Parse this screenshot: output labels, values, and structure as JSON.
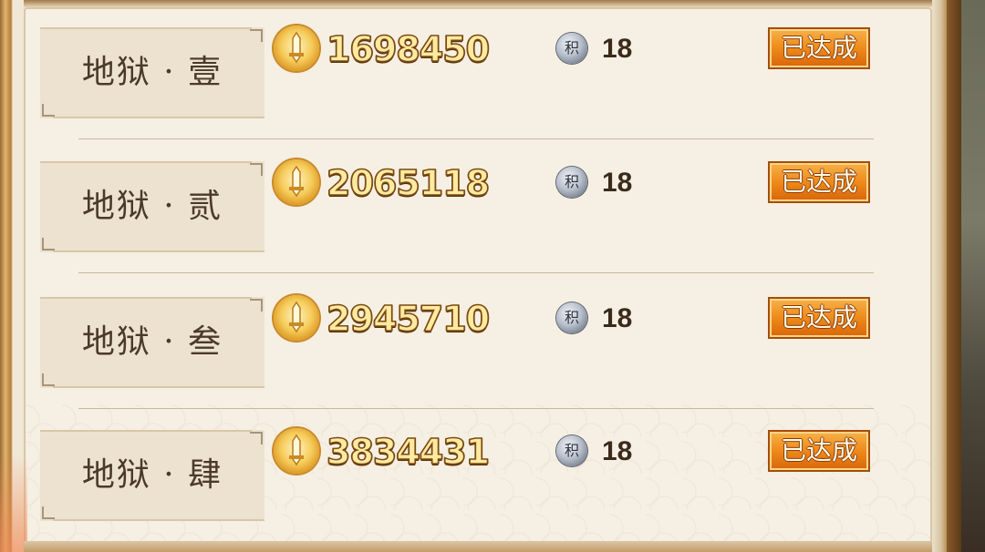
{
  "rows": [
    {
      "stage": "地狱 · 壹",
      "power": "1698450",
      "score": "18",
      "status": "已达成"
    },
    {
      "stage": "地狱 · 贰",
      "power": "2065118",
      "score": "18",
      "status": "已达成"
    },
    {
      "stage": "地狱 · 叁",
      "power": "2945710",
      "score": "18",
      "status": "已达成"
    },
    {
      "stage": "地狱 · 肆",
      "power": "3834431",
      "score": "18",
      "status": "已达成"
    }
  ],
  "icons": {
    "power": "sword-medal-icon",
    "score": "score-coin-icon",
    "score_glyph": "积"
  },
  "colors": {
    "button": "#ee8a1a",
    "power_text": "#ffeaa0",
    "panel": "#f6efe3"
  }
}
